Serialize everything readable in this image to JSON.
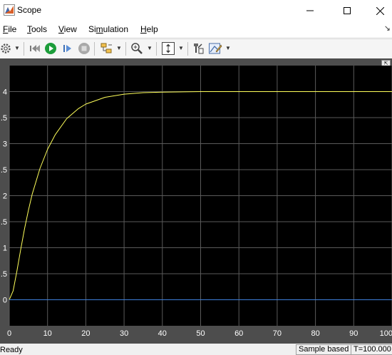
{
  "window": {
    "title": "Scope",
    "minimize": "—",
    "maximize": "☐",
    "close": "✕"
  },
  "menu": {
    "items": [
      "File",
      "Tools",
      "View",
      "Simulation",
      "Help"
    ],
    "mnemonics": [
      "F",
      "T",
      "V",
      "m",
      "H"
    ],
    "overflow_arrow": "↘"
  },
  "toolbar": {
    "icons": [
      "gear-icon",
      "rewind-icon",
      "run-icon",
      "step-forward-icon",
      "stop-icon",
      "highlight-block-icon",
      "zoom-icon",
      "scale-axes-icon",
      "write-access-icon",
      "cursor-measurements-icon"
    ]
  },
  "colors": {
    "plot_bg": "#000000",
    "frame": "#4d4d4d",
    "grid": "#5a5a5a",
    "signal_1": "#ffff5a",
    "signal_2": "#3d7fd9"
  },
  "status": {
    "left": "Ready",
    "mode": "Sample based",
    "time": "T=100.000"
  },
  "chart_data": {
    "type": "line",
    "title": "",
    "xlabel": "",
    "ylabel": "",
    "xlim": [
      0,
      100
    ],
    "ylim": [
      -0.5,
      4.5
    ],
    "xticks": [
      0,
      10,
      20,
      30,
      40,
      50,
      60,
      70,
      80,
      90,
      100
    ],
    "yticks": [
      0,
      0.5,
      1,
      1.5,
      2,
      2.5,
      3,
      3.5,
      4
    ],
    "ytick_labels": [
      "0",
      ".5",
      "1",
      ".5",
      "2",
      ".5",
      "3",
      ".5",
      "4"
    ],
    "grid": true,
    "series": [
      {
        "color": "#ffff5a",
        "x": [
          0,
          1,
          2,
          3,
          4,
          5,
          6,
          8,
          10,
          12,
          15,
          18,
          20,
          25,
          30,
          35,
          40,
          50,
          60,
          70,
          80,
          90,
          100
        ],
        "y": [
          0,
          0.17,
          0.55,
          0.97,
          1.37,
          1.72,
          2.03,
          2.52,
          2.89,
          3.17,
          3.48,
          3.67,
          3.76,
          3.89,
          3.95,
          3.98,
          3.99,
          4.0,
          4.0,
          4.0,
          4.0,
          4.0,
          4.0
        ]
      },
      {
        "color": "#3d7fd9",
        "x": [
          0,
          100
        ],
        "y": [
          0,
          0
        ]
      }
    ]
  }
}
